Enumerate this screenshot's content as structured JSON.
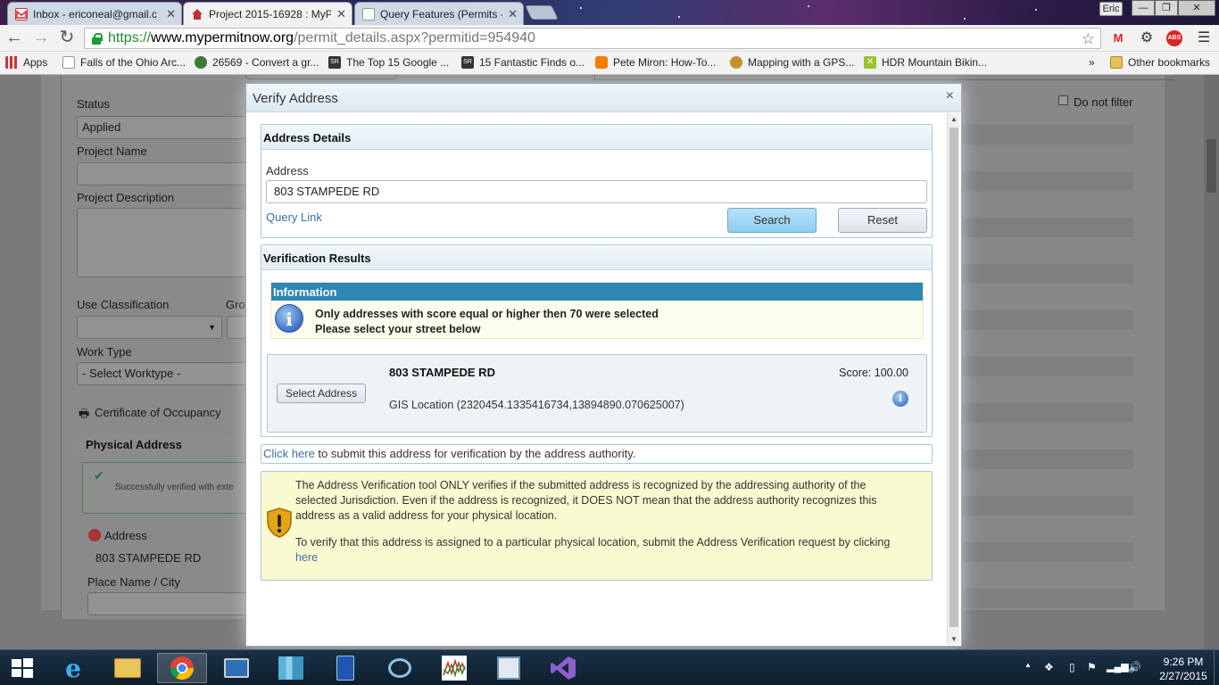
{
  "browser": {
    "tabs": [
      {
        "title": "Inbox - ericoneal@gmail.c",
        "icon": "gmail-icon"
      },
      {
        "title": "Project 2015-16928 : MyPe",
        "icon": "house-icon",
        "active": true
      },
      {
        "title": "Query Features (Permits -",
        "icon": "page-icon"
      }
    ],
    "user_badge": "Eric",
    "url": {
      "scheme": "https://",
      "host": "www.mypermitnow.org",
      "path": "/permit_details.aspx?permitid=954940"
    },
    "bookmarks": [
      {
        "label": "Apps",
        "icon": "apps-grid-icon"
      },
      {
        "label": "Falls of the Ohio Arc...",
        "icon": "page-icon"
      },
      {
        "label": "26569 - Convert a gr...",
        "icon": "globe-icon"
      },
      {
        "label": "The Top 15 Google ...",
        "icon": "sr-icon"
      },
      {
        "label": "15 Fantastic Finds o...",
        "icon": "sr-icon"
      },
      {
        "label": "Pete Miron: How-To...",
        "icon": "blogger-icon"
      },
      {
        "label": "Mapping with a GPS...",
        "icon": "lion-icon"
      },
      {
        "label": "HDR Mountain Bikin...",
        "icon": "x-icon"
      }
    ],
    "bookmarks_overflow": "»",
    "other_bookmarks": "Other bookmarks"
  },
  "background_page": {
    "status_label": "Status",
    "status_value": "Applied",
    "project_name_label": "Project Name",
    "project_description_label": "Project Description",
    "use_classification_label": "Use Classification",
    "group_label_fragment": "Gro",
    "work_type_label": "Work Type",
    "work_type_value": "- Select Worktype -",
    "certificate_label": "Certificate of Occupancy",
    "physical_address_header": "Physical Address",
    "verified_text": "Successfully verified with exte",
    "address_label": "Address",
    "address_value": "803 STAMPEDE RD",
    "place_label": "Place Name / City",
    "do_not_filter": "Do not filter"
  },
  "modal": {
    "title": "Verify Address",
    "close": "×",
    "address_details": {
      "header": "Address Details",
      "address_label": "Address",
      "address_value": "803 STAMPEDE RD",
      "query_link": "Query Link",
      "search_button": "Search",
      "reset_button": "Reset"
    },
    "verification_results": {
      "header": "Verification Results",
      "info_header": "Information",
      "info_line1": "Only addresses with score equal or higher then 70 were selected",
      "info_line2": "Please select your street below",
      "result": {
        "select_button": "Select Address",
        "address": "803 STAMPEDE RD",
        "score": "Score: 100.00",
        "gis_location": "GIS Location (2320454.1335416734,13894890.070625007)"
      }
    },
    "submit_link": "Click here",
    "submit_text": " to submit this address for verification by the address authority.",
    "warning_p1_line1": "The Address Verification tool ONLY verifies if the submitted address is recognized by the addressing authority of the",
    "warning_p1_line2": "selected Jurisdiction. Even if the address is recognized, it DOES NOT mean that the address authority recognizes this",
    "warning_p1_line3": "address as a valid address for your physical location.",
    "warning_p2_line1": "To verify that this address is assigned to a particular physical location, submit the Address Verification request by clicking",
    "warning_p2_link": "here"
  },
  "taskbar": {
    "clock_time": "9:26 PM",
    "clock_date": "2/27/2015"
  }
}
